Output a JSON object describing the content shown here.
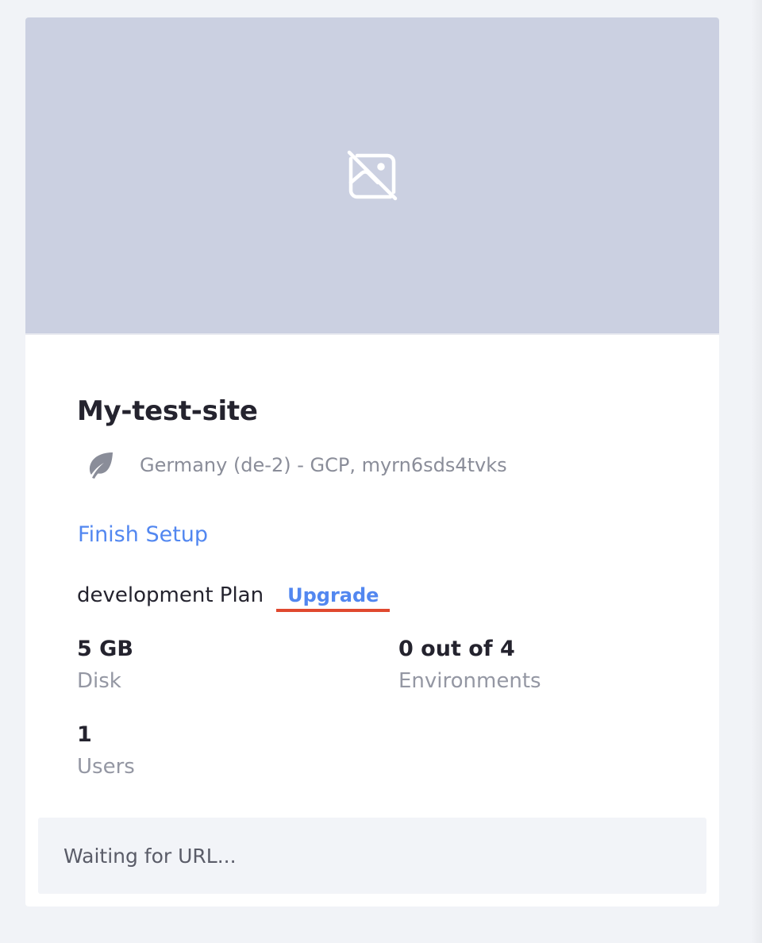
{
  "site": {
    "title": "My-test-site",
    "location_info": "Germany (de-2) - GCP, myrn6sds4tvks",
    "thumbnail_icon": "image-off-icon",
    "region_icon": "leaf-icon"
  },
  "actions": {
    "finish_setup_label": "Finish Setup",
    "upgrade_label": "Upgrade"
  },
  "plan": {
    "label": "development Plan"
  },
  "stats": {
    "disk": {
      "value": "5 GB",
      "label": "Disk"
    },
    "environments": {
      "value": "0 out of 4",
      "label": "Environments"
    },
    "users": {
      "value": "1",
      "label": "Users"
    }
  },
  "url_status": {
    "text": "Waiting for URL..."
  },
  "colors": {
    "thumbnail_bg": "#cbd0e1",
    "link": "#5287f0",
    "highlight_underline": "#e0492f",
    "title_text": "#24232e",
    "muted_text": "#8a8d99"
  }
}
